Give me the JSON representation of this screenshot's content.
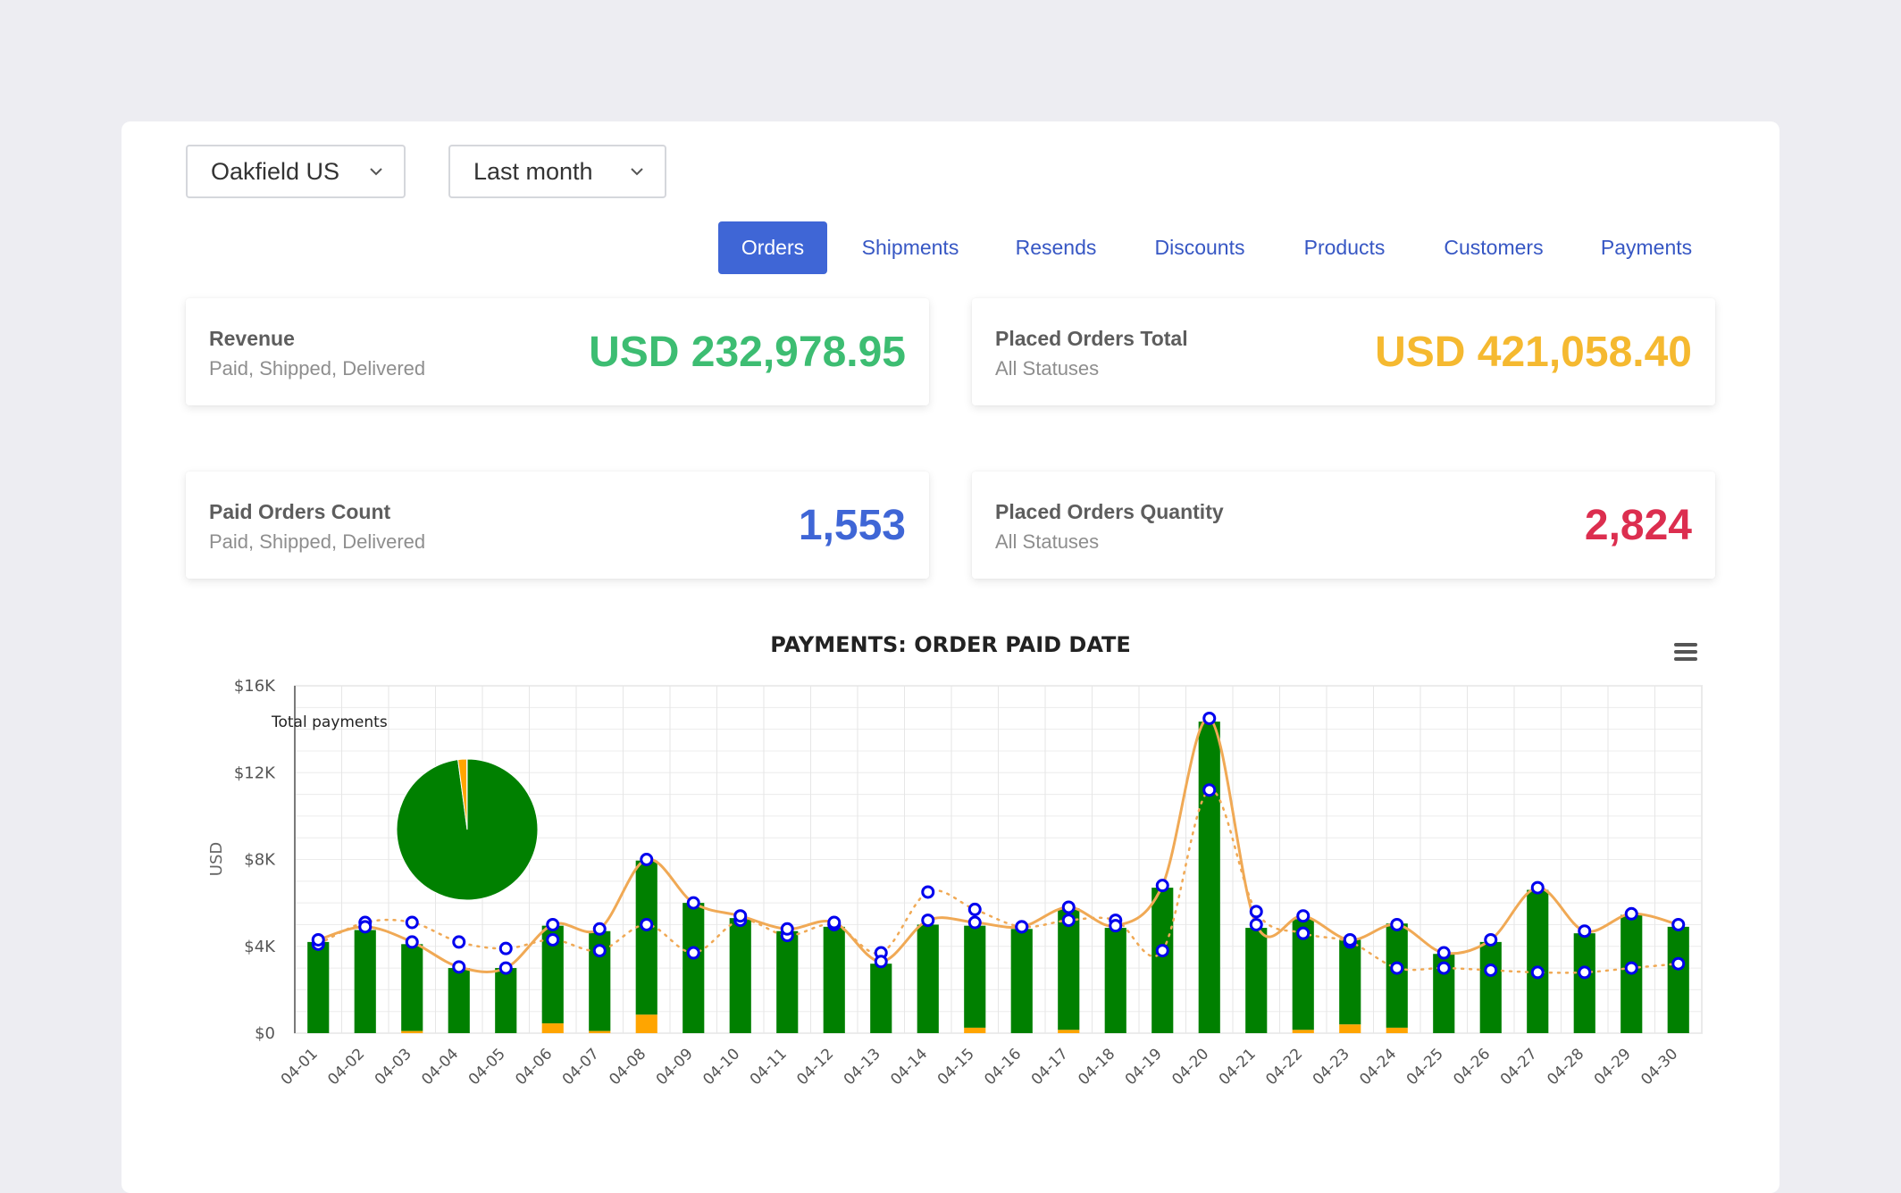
{
  "filters": {
    "store": "Oakfield US",
    "period": "Last month"
  },
  "tabs": [
    {
      "label": "Orders",
      "active": true
    },
    {
      "label": "Shipments",
      "active": false
    },
    {
      "label": "Resends",
      "active": false
    },
    {
      "label": "Discounts",
      "active": false
    },
    {
      "label": "Products",
      "active": false
    },
    {
      "label": "Customers",
      "active": false
    },
    {
      "label": "Payments",
      "active": false
    }
  ],
  "cards": {
    "revenue": {
      "title": "Revenue",
      "subtitle": "Paid, Shipped, Delivered",
      "value": "USD 232,978.95",
      "color": "#3dbd72"
    },
    "placed_total": {
      "title": "Placed Orders Total",
      "subtitle": "All Statuses",
      "value": "USD 421,058.40",
      "color": "#f5b930"
    },
    "paid_count": {
      "title": "Paid Orders Count",
      "subtitle": "Paid, Shipped, Delivered",
      "value": "1,553",
      "color": "#3f66d6"
    },
    "placed_qty": {
      "title": "Placed Orders Quantity",
      "subtitle": "All Statuses",
      "value": "2,824",
      "color": "#dc2e4f"
    }
  },
  "icons": {
    "dropdown": "chevron-down-icon",
    "chart_menu": "hamburger-menu-icon"
  },
  "colors": {
    "tab_active": "#3f66d6",
    "tab_text": "#3757c4",
    "bar_main": "#008000",
    "bar_secondary": "#ffa500",
    "line": "#f0a955",
    "marker_stroke": "#0000ee"
  },
  "chart_data": {
    "type": "bar",
    "title": "PAYMENTS: ORDER PAID DATE",
    "ylabel": "USD",
    "ylim": [
      0,
      16000
    ],
    "yticks": [
      0,
      4000,
      8000,
      12000,
      16000
    ],
    "ytick_labels": [
      "$0",
      "$4K",
      "$8K",
      "$12K",
      "$16K"
    ],
    "grid": true,
    "categories": [
      "04-01",
      "04-02",
      "04-03",
      "04-04",
      "04-05",
      "04-06",
      "04-07",
      "04-08",
      "04-09",
      "04-10",
      "04-11",
      "04-12",
      "04-13",
      "04-14",
      "04-15",
      "04-16",
      "04-17",
      "04-18",
      "04-19",
      "04-20",
      "04-21",
      "04-22",
      "04-23",
      "04-24",
      "04-25",
      "04-26",
      "04-27",
      "04-28",
      "04-29",
      "04-30"
    ],
    "series": [
      {
        "values": [
          4200,
          4750,
          4000,
          3000,
          3000,
          4500,
          4600,
          7100,
          6000,
          5300,
          4700,
          4900,
          3200,
          5000,
          4700,
          4800,
          5600,
          4850,
          6700,
          14350,
          4850,
          5100,
          3900,
          4800,
          3650,
          4200,
          6600,
          4600,
          5450,
          4900
        ]
      },
      {
        "values": [
          0,
          0,
          100,
          0,
          0,
          450,
          100,
          850,
          0,
          0,
          0,
          0,
          0,
          0,
          250,
          0,
          150,
          0,
          0,
          0,
          0,
          150,
          400,
          250,
          0,
          0,
          0,
          0,
          0,
          0
        ]
      }
    ],
    "line_solid": [
      4300,
      4900,
      4200,
      3050,
      3000,
      5000,
      4800,
      8000,
      6000,
      5400,
      4800,
      5100,
      3300,
      5200,
      5100,
      4900,
      5800,
      4950,
      6800,
      14500,
      5000,
      5400,
      4300,
      5000,
      3700,
      4300,
      6700,
      4700,
      5500,
      5000
    ],
    "line_dotted": [
      4100,
      5100,
      5100,
      4200,
      3900,
      4300,
      3800,
      5000,
      3700,
      5200,
      4500,
      5000,
      3700,
      6500,
      5700,
      4900,
      5200,
      5200,
      3800,
      11200,
      5600,
      4600,
      4200,
      3000,
      3000,
      2900,
      2800,
      2800,
      3000,
      3200
    ],
    "pie": {
      "title": "Total payments",
      "slices": [
        {
          "value": 97.9,
          "color": "#008000"
        },
        {
          "value": 2.0,
          "color": "#ffa500"
        },
        {
          "value": 0.1,
          "color": "#3f66d6"
        }
      ]
    }
  }
}
